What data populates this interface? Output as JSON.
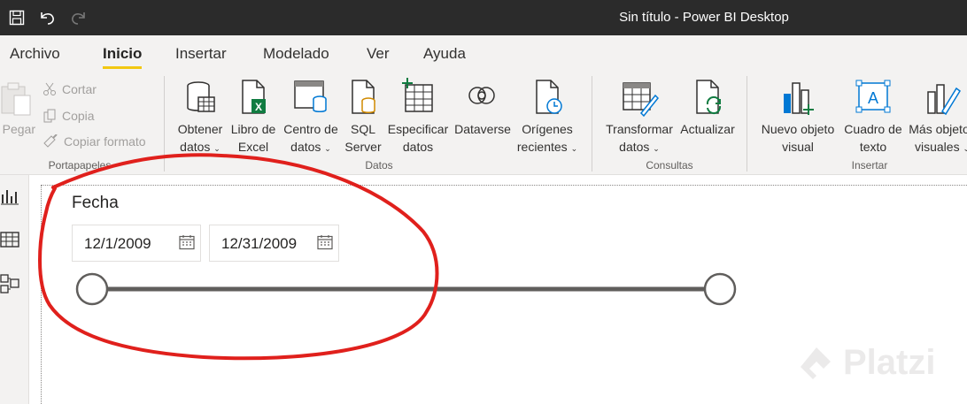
{
  "window": {
    "title": "Sin título - Power BI Desktop"
  },
  "quick_access": [
    "save-icon",
    "undo-icon",
    "redo-icon"
  ],
  "menu": {
    "tabs": [
      {
        "label": "Archivo",
        "active": false
      },
      {
        "label": "Inicio",
        "active": true
      },
      {
        "label": "Insertar",
        "active": false
      },
      {
        "label": "Modelado",
        "active": false
      },
      {
        "label": "Ver",
        "active": false
      },
      {
        "label": "Ayuda",
        "active": false
      }
    ],
    "accent": "#f2c811"
  },
  "ribbon": {
    "clipboard": {
      "label": "Portapapeles",
      "paste": "Pegar",
      "cut": "Cortar",
      "copy": "Copia",
      "format_painter": "Copiar formato"
    },
    "data": {
      "label": "Datos",
      "get_data": [
        "Obtener",
        "datos"
      ],
      "excel": [
        "Libro de",
        "Excel"
      ],
      "data_hub": [
        "Centro de",
        "datos"
      ],
      "sql": [
        "SQL",
        "Server"
      ],
      "enter_data": [
        "Especificar",
        "datos"
      ],
      "dataverse": [
        "Dataverse"
      ],
      "recent": [
        "Orígenes",
        "recientes"
      ]
    },
    "queries": {
      "label": "Consultas",
      "transform": [
        "Transformar",
        "datos"
      ],
      "refresh": [
        "Actualizar"
      ]
    },
    "insert": {
      "label": "Insertar",
      "new_visual": [
        "Nuevo objeto",
        "visual"
      ],
      "text_box": [
        "Cuadro de",
        "texto"
      ],
      "more_visuals": [
        "Más objetos",
        "visuales"
      ]
    }
  },
  "left_nav": [
    "report-view-icon",
    "data-view-icon",
    "model-view-icon"
  ],
  "slicer": {
    "title": "Fecha",
    "start_date": "12/1/2009",
    "end_date": "12/31/2009",
    "range_start_fraction": 0.0,
    "range_end_fraction": 1.0
  },
  "annotation": {
    "color": "#e0201c"
  },
  "watermark": "Platzi"
}
